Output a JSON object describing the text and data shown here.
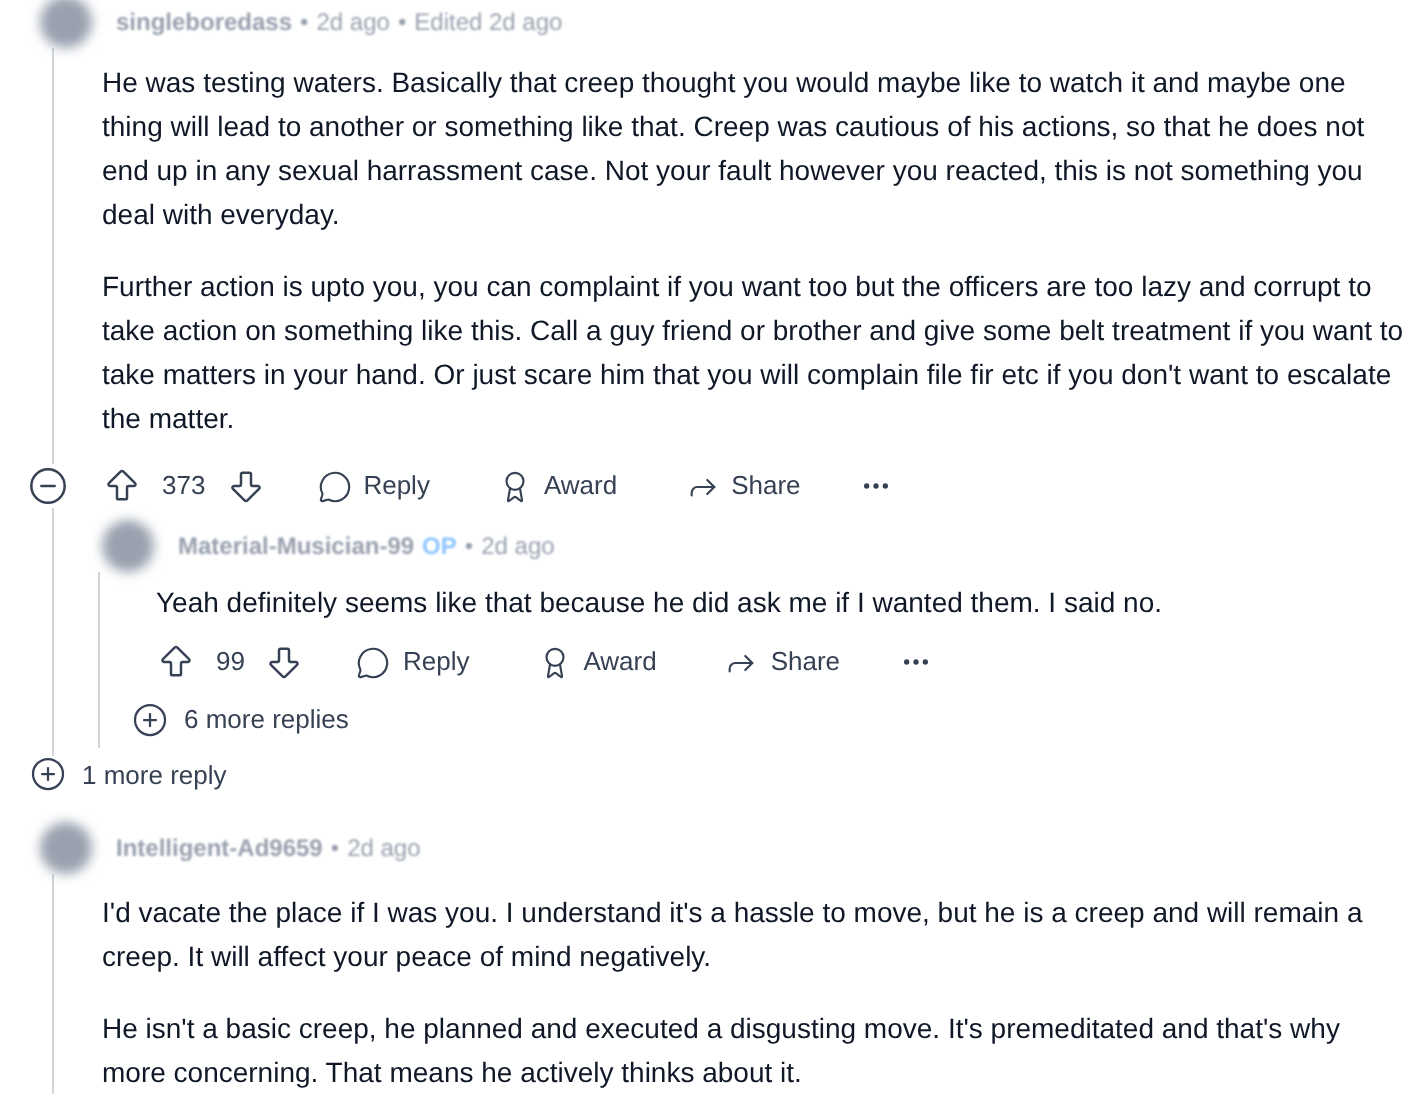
{
  "comments": [
    {
      "author": "singleboredass",
      "separator": "•",
      "time": "2d ago",
      "edited": "Edited 2d ago",
      "paragraphs": [
        "He was testing waters. Basically that creep thought you would maybe like to watch it and maybe one thing will lead to another or something like that. Creep was cautious of his actions, so that he does not end up in any sexual harrassment case. Not your fault however you reacted, this is not something you deal with everyday.",
        "Further action is upto you, you can complaint if you want too but the officers are too lazy and corrupt to take action on something like this. Call a guy friend or brother and give some belt treatment if you want to take matters in your hand. Or just scare him that you will complain file fir etc if you don't want to escalate the matter."
      ],
      "expanded": true,
      "votes": "373",
      "actions": [
        "Reply",
        "Award",
        "Share"
      ],
      "replies": [
        {
          "author": "Material-Musician-99",
          "badge": "OP",
          "separator": "•",
          "time": "2d ago",
          "paragraphs": [
            "Yeah definitely seems like that because he did ask me if I wanted them. I said no."
          ],
          "votes": "99",
          "actions": [
            "Reply",
            "Award",
            "Share"
          ],
          "more_replies": "6 more replies"
        }
      ],
      "more_replies": "1 more reply"
    },
    {
      "author": "Intelligent-Ad9659",
      "separator": "•",
      "time": "2d ago",
      "paragraphs": [
        "I'd vacate the place if I was you. I understand it's a hassle to move, but he is a creep and will remain a creep. It will affect your peace of mind negatively.",
        "He isn't a basic creep, he planned and executed a disgusting move. It's premeditated and that's why more concerning. That means he actively thinks about it."
      ]
    }
  ]
}
